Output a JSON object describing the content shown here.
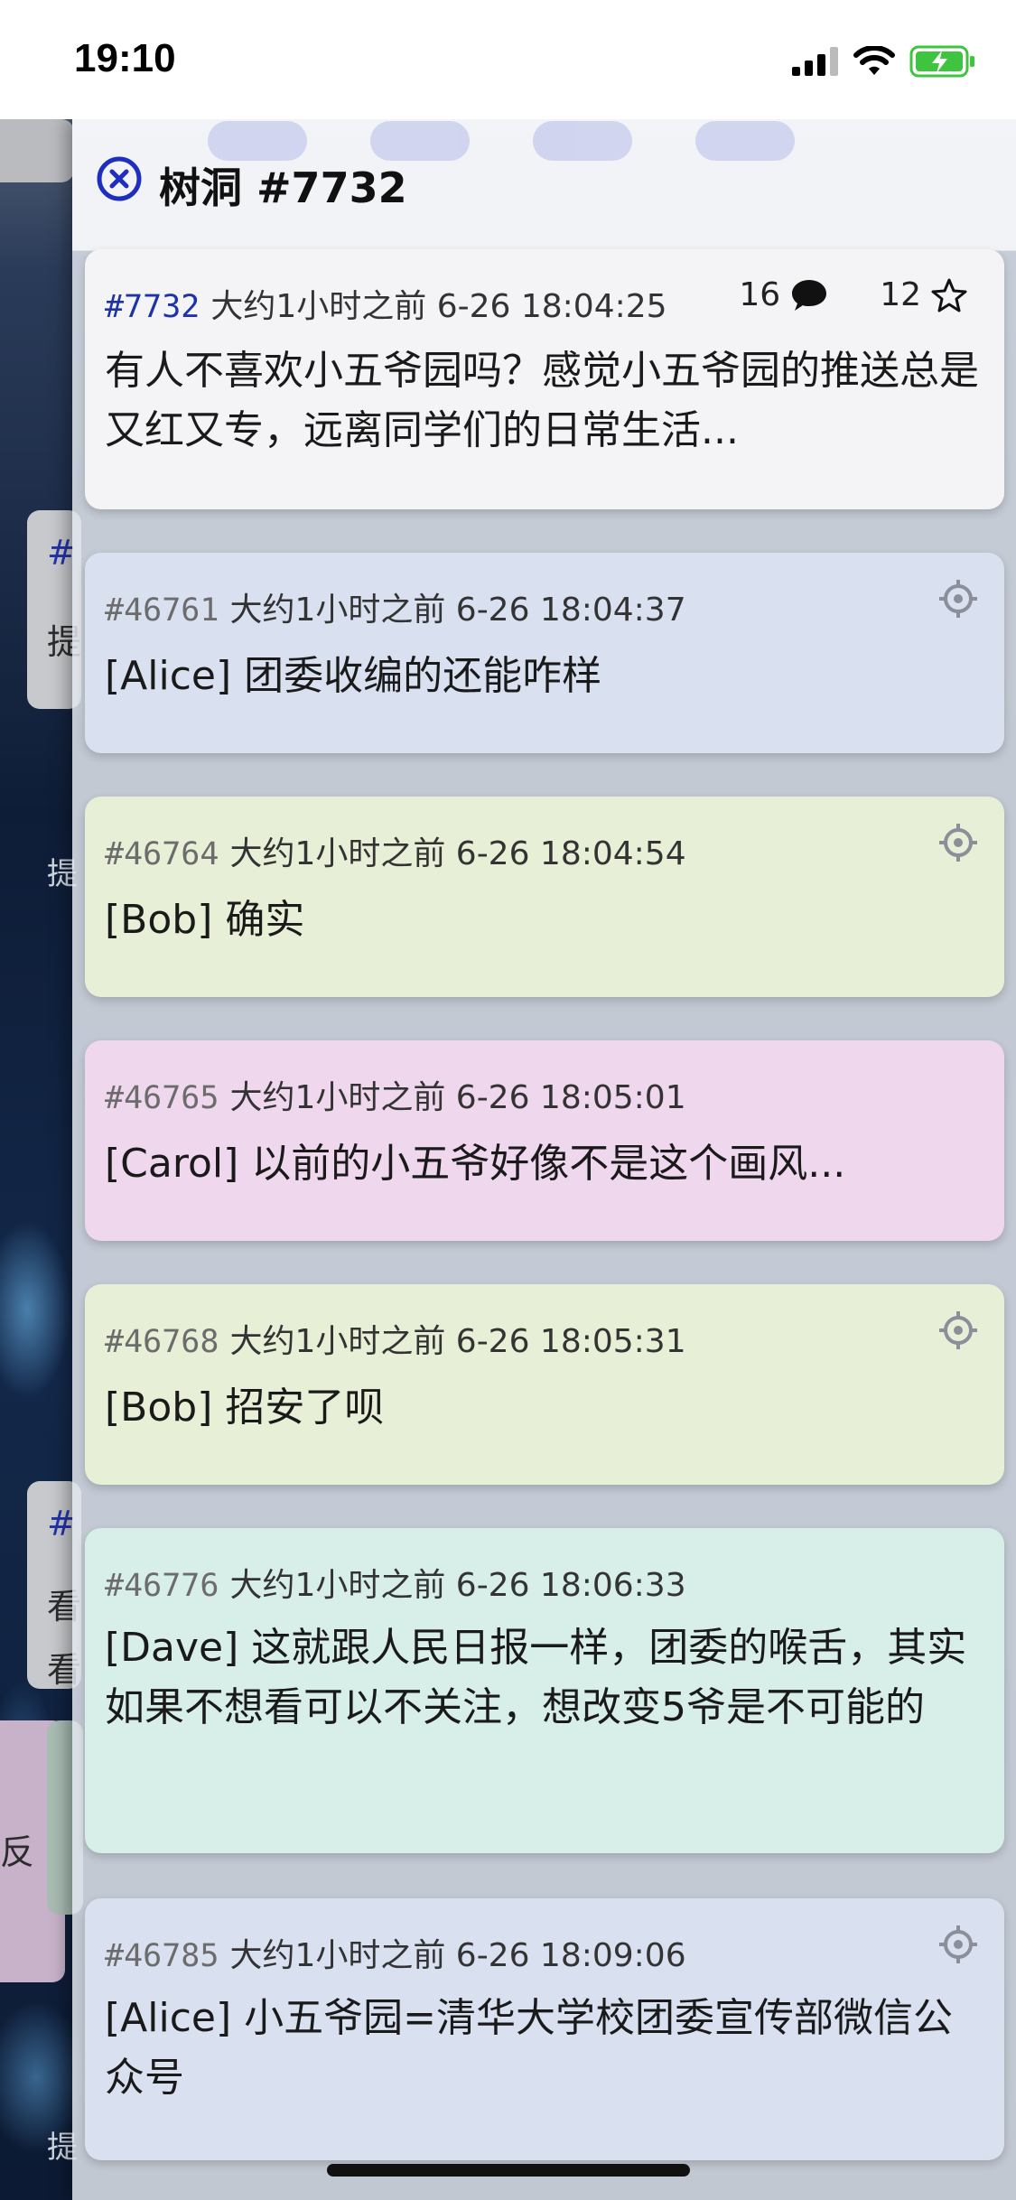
{
  "status": {
    "time": "19:10"
  },
  "sheet": {
    "title": "树洞 #7732"
  },
  "main_post": {
    "id": "#7732",
    "time_text": "大约1小时之前 6-26 18:04:25",
    "reply_count": "16",
    "star_count": "12",
    "text": "有人不喜欢小五爷园吗？感觉小五爷园的推送总是又红又专，远离同学们的日常生活..."
  },
  "replies": [
    {
      "id": "#46761",
      "time_text": "大约1小时之前 6-26 18:04:37",
      "text": "[Alice] 团委收编的还能咋样",
      "color": "#d9e1f1",
      "has_locate": true
    },
    {
      "id": "#46764",
      "time_text": "大约1小时之前 6-26 18:04:54",
      "text": "[Bob] 确实",
      "color": "#e7efd7",
      "has_locate": true
    },
    {
      "id": "#46765",
      "time_text": "大约1小时之前 6-26 18:05:01",
      "text": "[Carol] 以前的小五爷好像不是这个画风...",
      "color": "#efd7ee",
      "has_locate": false
    },
    {
      "id": "#46768",
      "time_text": "大约1小时之前 6-26 18:05:31",
      "text": "[Bob] 招安了呗",
      "color": "#e7efd7",
      "has_locate": true
    },
    {
      "id": "#46776",
      "time_text": "大约1小时之前 6-26 18:06:33",
      "text": "[Dave] 这就跟人民日报一样，团委的喉舌，其实如果不想看可以不关注，想改变5爷是不可能的",
      "color": "#d8efe9",
      "has_locate": false
    },
    {
      "id": "#46785",
      "time_text": "大约1小时之前 6-26 18:09:06",
      "text": "[Alice] 小五爷园=清华大学校团委宣传部微信公众号",
      "color": "#d9e1f1",
      "has_locate": true
    }
  ],
  "background_fragments": {
    "frag_hash": "#",
    "frag_a": "提",
    "frag_b": "提",
    "frag_c": "看",
    "frag_d": "看",
    "frag_e": "反",
    "frag_f": "提"
  },
  "icons": {
    "close": "close-circle-icon",
    "comment": "comment-bubble-icon",
    "star": "star-outline-icon",
    "locate": "crosshair-locate-icon",
    "signal": "cellular-signal-icon",
    "wifi": "wifi-icon",
    "battery": "battery-charging-icon"
  },
  "colors": {
    "accent": "#1e33a8",
    "battery": "#3ec43e"
  }
}
